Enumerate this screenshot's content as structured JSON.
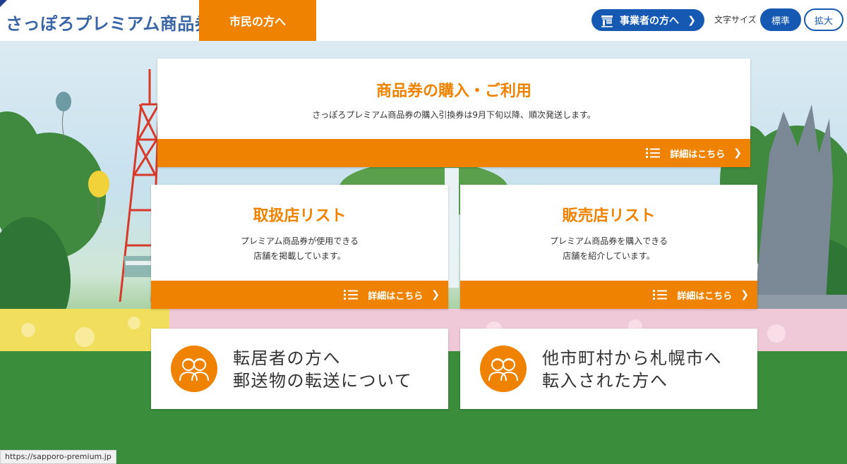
{
  "header": {
    "logo": "さっぽろプレミアム商品券",
    "tab_citizen": "市民の方へ",
    "business_button": "事業者の方へ",
    "font_size_label": "文字サイズ",
    "font_size_standard": "標準",
    "font_size_large": "拡大"
  },
  "cards": {
    "purchase": {
      "title": "商品券の購入・ご利用",
      "desc": "さっぽろプレミアム商品券の購入引換券は9月下旬以降、順次発送します。",
      "link": "詳細はこちら"
    },
    "handling_stores": {
      "title": "取扱店リスト",
      "desc_line1": "プレミアム商品券が使用できる",
      "desc_line2": "店舗を掲載しています。",
      "link": "詳細はこちら"
    },
    "sales_stores": {
      "title": "販売店リスト",
      "desc_line1": "プレミアム商品券を購入できる",
      "desc_line2": "店舗を紹介しています。",
      "link": "詳細はこちら"
    },
    "moved_out": {
      "line1": "転居者の方へ",
      "line2": "郵送物の転送について"
    },
    "moved_in": {
      "line1": "他市町村から札幌市へ",
      "line2": "転入された方へ"
    }
  },
  "status_bar": {
    "url": "https://sapporo-premium.jp"
  },
  "colors": {
    "accent": "#ef8200",
    "brand_blue": "#1559b3",
    "logo_blue": "#3a65a6"
  }
}
